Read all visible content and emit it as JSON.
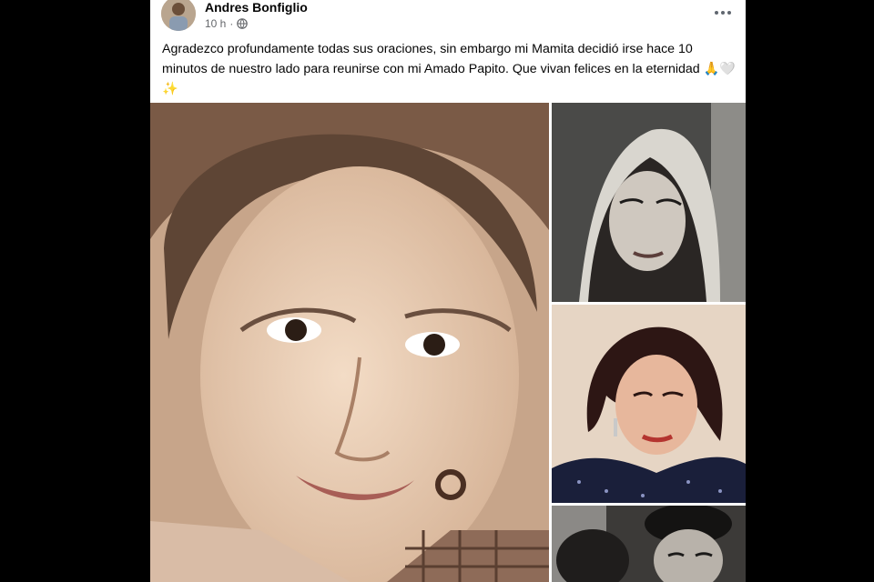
{
  "post": {
    "author": "Andres Bonfiglio",
    "time": "10 h",
    "separator": "·",
    "caption": "Agradezco profundamente todas sus oraciones, sin embargo mi Mamita decidió irse hace 10 minutos de nuestro lado para reunirse con mi Amado Papito. Que vivan felices en la eternidad 🙏🤍✨",
    "more_icon": "more-horizontal-icon",
    "audience_icon": "globe-icon"
  },
  "photos": [
    {
      "name": "photo-main",
      "tone": "sepia"
    },
    {
      "name": "photo-headscarf",
      "tone": "black-and-white"
    },
    {
      "name": "photo-portrait-color",
      "tone": "color"
    },
    {
      "name": "photo-couple",
      "tone": "black-and-white"
    }
  ],
  "colors": {
    "background": "#000000",
    "card": "#ffffff",
    "text_primary": "#050505",
    "text_secondary": "#65676b"
  }
}
